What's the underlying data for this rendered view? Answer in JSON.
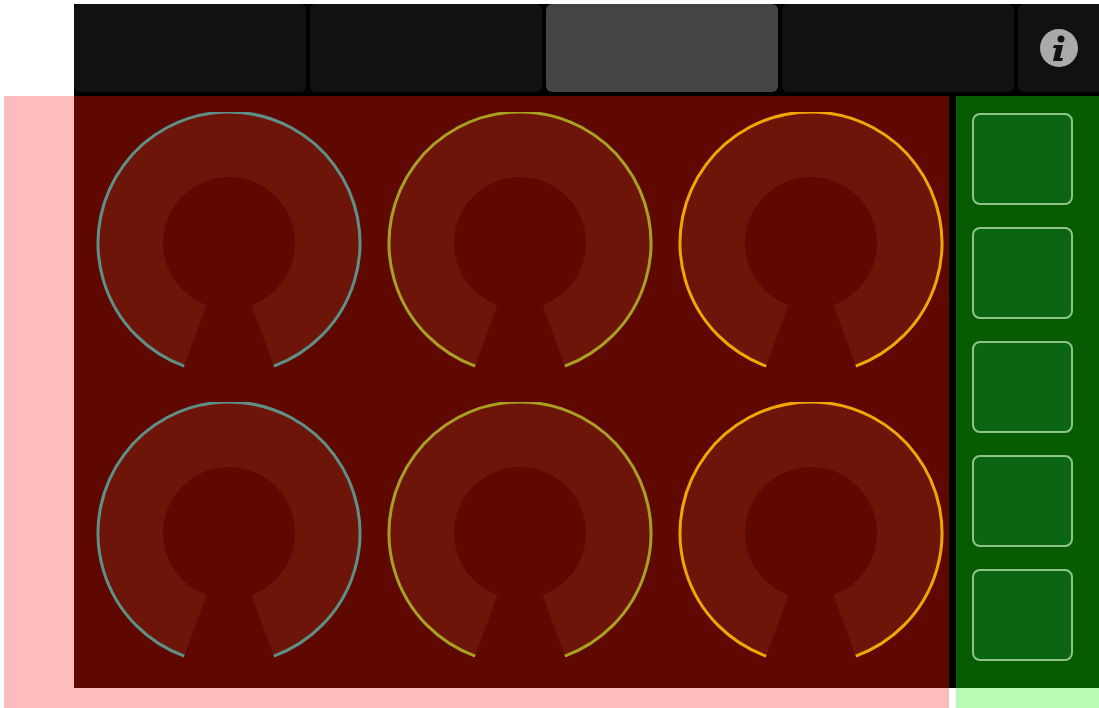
{
  "tabs": [
    {
      "selected": false
    },
    {
      "selected": false
    },
    {
      "selected": true
    },
    {
      "selected": false
    }
  ],
  "knobs": [
    {
      "color": "#5f9088"
    },
    {
      "color": "#a8a020"
    },
    {
      "color": "#f0a800"
    },
    {
      "color": "#5f9088"
    },
    {
      "color": "#a8a020"
    },
    {
      "color": "#f0a800"
    }
  ],
  "pads": [
    {
      "kind": "pad"
    },
    {
      "kind": "pad"
    },
    {
      "kind": "pad"
    },
    {
      "kind": "pad"
    },
    {
      "kind": "pad"
    }
  ]
}
